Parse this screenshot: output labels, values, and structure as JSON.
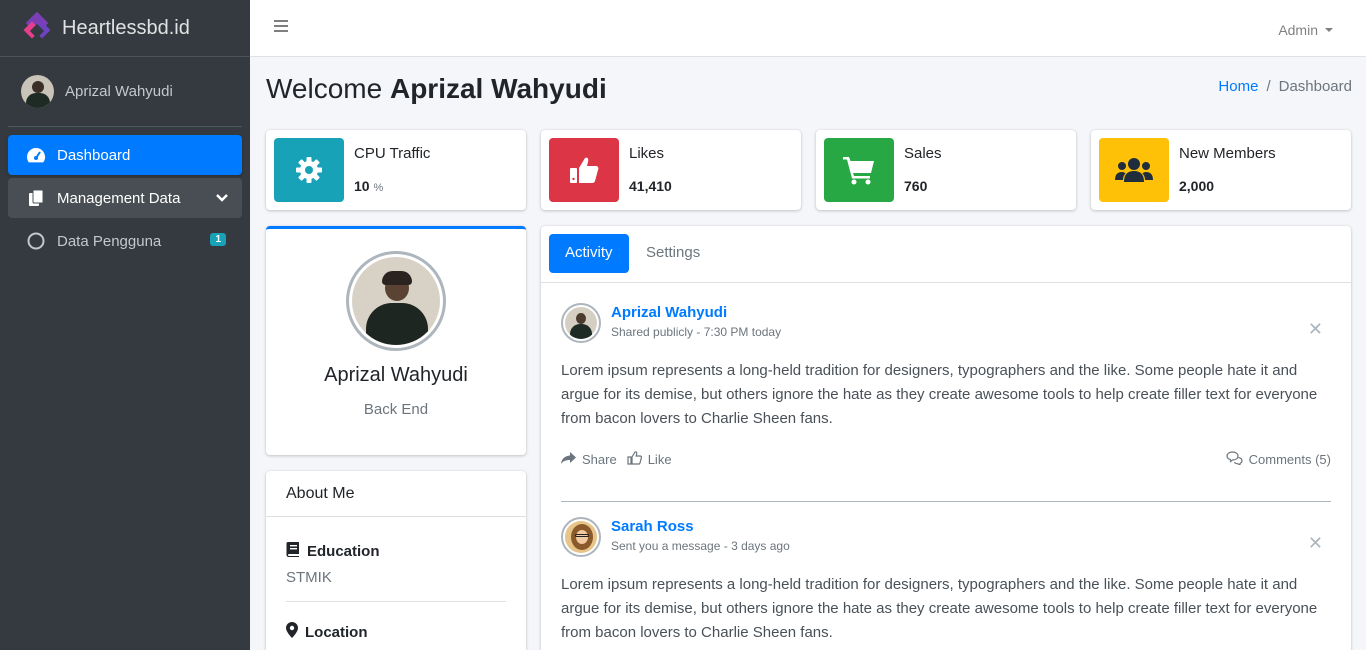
{
  "brand": {
    "name": "Heartlessbd.id"
  },
  "sidebar": {
    "user": "Aprizal Wahyudi",
    "items": [
      {
        "label": "Dashboard",
        "icon": "tachometer-icon",
        "state": "active"
      },
      {
        "label": "Management Data",
        "icon": "copy-icon",
        "state": "open"
      },
      {
        "label": "Data Pengguna",
        "icon": "circle-icon",
        "badge": "1"
      }
    ]
  },
  "topbar": {
    "user_menu": "Admin"
  },
  "header": {
    "welcome_prefix": "Welcome",
    "welcome_name": "Aprizal Wahyudi",
    "breadcrumb": {
      "home": "Home",
      "separator": "/",
      "current": "Dashboard"
    }
  },
  "info_boxes": [
    {
      "label": "CPU Traffic",
      "value": "10",
      "unit": "%",
      "color": "#17a2b8",
      "icon": "gear-icon"
    },
    {
      "label": "Likes",
      "value": "41,410",
      "color": "#dc3545",
      "icon": "thumbs-up-icon"
    },
    {
      "label": "Sales",
      "value": "760",
      "color": "#28a745",
      "icon": "shopping-cart-icon"
    },
    {
      "label": "New Members",
      "value": "2,000",
      "color": "#ffc107",
      "icon": "users-icon"
    }
  ],
  "profile": {
    "name": "Aprizal Wahyudi",
    "role": "Back End"
  },
  "about": {
    "title": "About Me",
    "education": {
      "title": "Education",
      "value": "STMIK"
    },
    "location": {
      "title": "Location"
    }
  },
  "tabs": {
    "active": "Activity",
    "other": "Settings"
  },
  "posts": [
    {
      "user": "Aprizal Wahyudi",
      "meta": "Shared publicly - 7:30 PM today",
      "text": "Lorem ipsum represents a long-held tradition for designers, typographers and the like. Some people hate it and argue for its demise, but others ignore the hate as they create awesome tools to help create filler text for everyone from bacon lovers to Charlie Sheen fans.",
      "share": "Share",
      "like": "Like",
      "comments": "Comments (5)"
    },
    {
      "user": "Sarah Ross",
      "meta": "Sent you a message - 3 days ago",
      "text": "Lorem ipsum represents a long-held tradition for designers, typographers and the like. Some people hate it and argue for its demise, but others ignore the hate as they create awesome tools to help create filler text for everyone from bacon lovers to Charlie Sheen fans."
    }
  ],
  "colors": {
    "primary": "#007bff",
    "sidebar": "#343a40"
  }
}
